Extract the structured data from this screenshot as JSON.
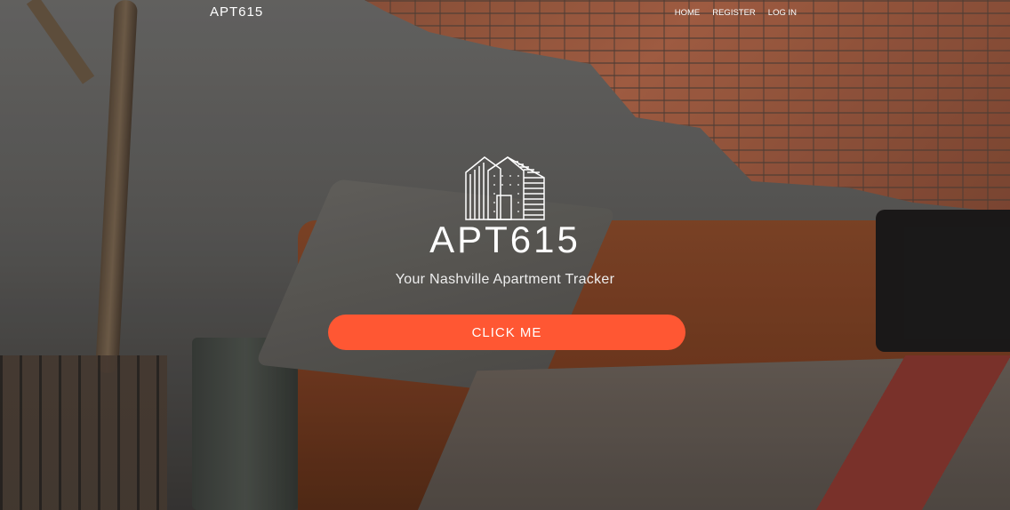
{
  "nav": {
    "brand": "APT615",
    "links": [
      "HOME",
      "REGISTER",
      "LOG IN"
    ]
  },
  "hero": {
    "title": "APT615",
    "tagline": "Your Nashville Apartment Tracker",
    "cta_label": "CLICK ME"
  },
  "colors": {
    "accent": "#ff5733"
  }
}
